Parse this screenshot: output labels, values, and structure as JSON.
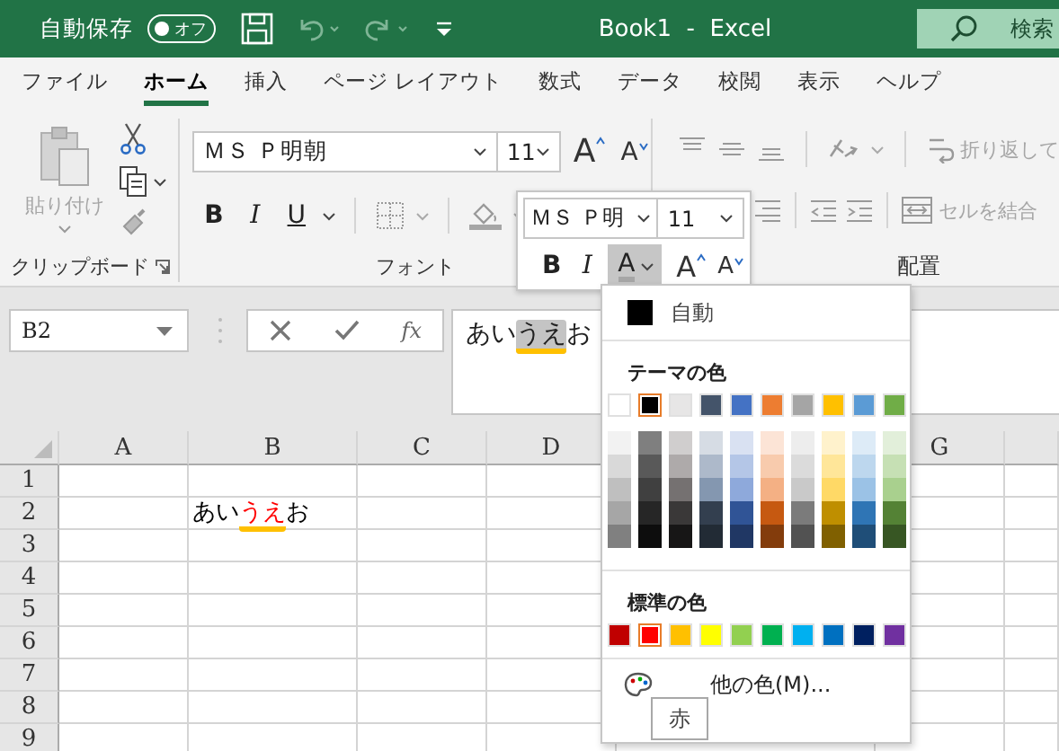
{
  "title_bar": {
    "autosave_label": "自動保存",
    "autosave_toggle": {
      "label": "オフ",
      "on": false
    },
    "title": "Book1  -  Excel",
    "search": {
      "placeholder": "検索"
    }
  },
  "tabs": [
    {
      "label": "ファイル",
      "selected": false
    },
    {
      "label": "ホーム",
      "selected": true
    },
    {
      "label": "挿入",
      "selected": false
    },
    {
      "label": "ページ レイアウト",
      "selected": false
    },
    {
      "label": "数式",
      "selected": false
    },
    {
      "label": "データ",
      "selected": false
    },
    {
      "label": "校閲",
      "selected": false
    },
    {
      "label": "表示",
      "selected": false
    },
    {
      "label": "ヘルプ",
      "selected": false
    }
  ],
  "ribbon": {
    "clipboard": {
      "paste": {
        "label": "貼り付け",
        "disabled": true
      },
      "group_label": "クリップボード"
    },
    "font": {
      "font_name": "ＭＳ Ｐ明朝",
      "font_size": "11",
      "grow_font": "A",
      "shrink_font": "A",
      "bold": "B",
      "italic": "I",
      "underline": "U",
      "group_label": "フォント"
    },
    "alignment": {
      "wrap_text": {
        "label": "折り返して",
        "disabled": true
      },
      "merge": {
        "label": "セルを結合",
        "disabled": true
      },
      "group_label": "配置"
    }
  },
  "formula_bar": {
    "name_box": "B2",
    "function_symbol": "fx",
    "content": [
      {
        "text": "あい",
        "selected": false,
        "underlined": false
      },
      {
        "text": "うえ",
        "selected": true,
        "underlined": true
      },
      {
        "text": "お",
        "selected": false,
        "underlined": false
      }
    ]
  },
  "sheet": {
    "columns": [
      "A",
      "B",
      "C",
      "D",
      "G"
    ],
    "rows": [
      {
        "label": "1"
      },
      {
        "label": "2",
        "content": [
          {
            "text": "あい",
            "color": "#000000",
            "underlined": false
          },
          {
            "text": "うえ",
            "color": "#ff0000",
            "underlined": true
          },
          {
            "text": "お",
            "color": "#000000",
            "underlined": false
          }
        ]
      },
      {
        "label": "3"
      },
      {
        "label": "4"
      },
      {
        "label": "5"
      },
      {
        "label": "6"
      },
      {
        "label": "7"
      },
      {
        "label": "8"
      },
      {
        "label": "9"
      }
    ]
  },
  "mini_toolbar": {
    "font_name": "ＭＳ Ｐ明",
    "font_size": "11",
    "bold": "B",
    "italic": "I",
    "font_color": {
      "label": "A",
      "pressed": true
    },
    "grow_font": "A",
    "shrink_font": "A"
  },
  "color_menu": {
    "automatic": {
      "label": "自動",
      "color": "#000000"
    },
    "theme_heading": "テーマの色",
    "theme_colors": [
      {
        "color": "#ffffff",
        "selected": false,
        "shades": [
          {
            "color": "#f2f2f2"
          },
          {
            "color": "#d9d9d9"
          },
          {
            "color": "#bfbfbf"
          },
          {
            "color": "#a6a6a6"
          },
          {
            "color": "#808080"
          }
        ]
      },
      {
        "color": "#000000",
        "selected": true,
        "shades": [
          {
            "color": "#7f7f7f"
          },
          {
            "color": "#595959"
          },
          {
            "color": "#404040"
          },
          {
            "color": "#262626"
          },
          {
            "color": "#0d0d0d"
          }
        ]
      },
      {
        "color": "#e7e6e6",
        "selected": false,
        "shades": [
          {
            "color": "#d0cece"
          },
          {
            "color": "#aeaaaa"
          },
          {
            "color": "#757171"
          },
          {
            "color": "#3a3838"
          },
          {
            "color": "#171616"
          }
        ]
      },
      {
        "color": "#44546a",
        "selected": false,
        "shades": [
          {
            "color": "#d6dce4"
          },
          {
            "color": "#adb9ca"
          },
          {
            "color": "#8497b0"
          },
          {
            "color": "#333f4f"
          },
          {
            "color": "#222b35"
          }
        ]
      },
      {
        "color": "#4472c4",
        "selected": false,
        "shades": [
          {
            "color": "#d9e1f2"
          },
          {
            "color": "#b4c6e7"
          },
          {
            "color": "#8ea9db"
          },
          {
            "color": "#305496"
          },
          {
            "color": "#203764"
          }
        ]
      },
      {
        "color": "#ed7d31",
        "selected": false,
        "shades": [
          {
            "color": "#fce4d6"
          },
          {
            "color": "#f8cbad"
          },
          {
            "color": "#f4b084"
          },
          {
            "color": "#c65911"
          },
          {
            "color": "#833c0c"
          }
        ]
      },
      {
        "color": "#a5a5a5",
        "selected": false,
        "shades": [
          {
            "color": "#ededed"
          },
          {
            "color": "#dbdbdb"
          },
          {
            "color": "#c9c9c9"
          },
          {
            "color": "#7b7b7b"
          },
          {
            "color": "#525252"
          }
        ]
      },
      {
        "color": "#ffc000",
        "selected": false,
        "shades": [
          {
            "color": "#fff2cc"
          },
          {
            "color": "#ffe699"
          },
          {
            "color": "#ffd966"
          },
          {
            "color": "#bf8f00"
          },
          {
            "color": "#806000"
          }
        ]
      },
      {
        "color": "#5b9bd5",
        "selected": false,
        "shades": [
          {
            "color": "#ddebf7"
          },
          {
            "color": "#bdd7ee"
          },
          {
            "color": "#9bc2e6"
          },
          {
            "color": "#2f75b5"
          },
          {
            "color": "#1f4e78"
          }
        ]
      },
      {
        "color": "#70ad47",
        "selected": false,
        "shades": [
          {
            "color": "#e2efda"
          },
          {
            "color": "#c6e0b4"
          },
          {
            "color": "#a9d08e"
          },
          {
            "color": "#548235"
          },
          {
            "color": "#375623"
          }
        ]
      }
    ],
    "standard_heading": "標準の色",
    "standard_colors": [
      {
        "color": "#c00000",
        "selected": false
      },
      {
        "color": "#ff0000",
        "selected": true
      },
      {
        "color": "#ffc000",
        "selected": false
      },
      {
        "color": "#ffff00",
        "selected": false
      },
      {
        "color": "#92d050",
        "selected": false
      },
      {
        "color": "#00b050",
        "selected": false
      },
      {
        "color": "#00b0f0",
        "selected": false
      },
      {
        "color": "#0070c0",
        "selected": false
      },
      {
        "color": "#002060",
        "selected": false
      },
      {
        "color": "#7030a0",
        "selected": false
      }
    ],
    "more_colors": "他の色(M)..."
  },
  "tooltip": "赤"
}
